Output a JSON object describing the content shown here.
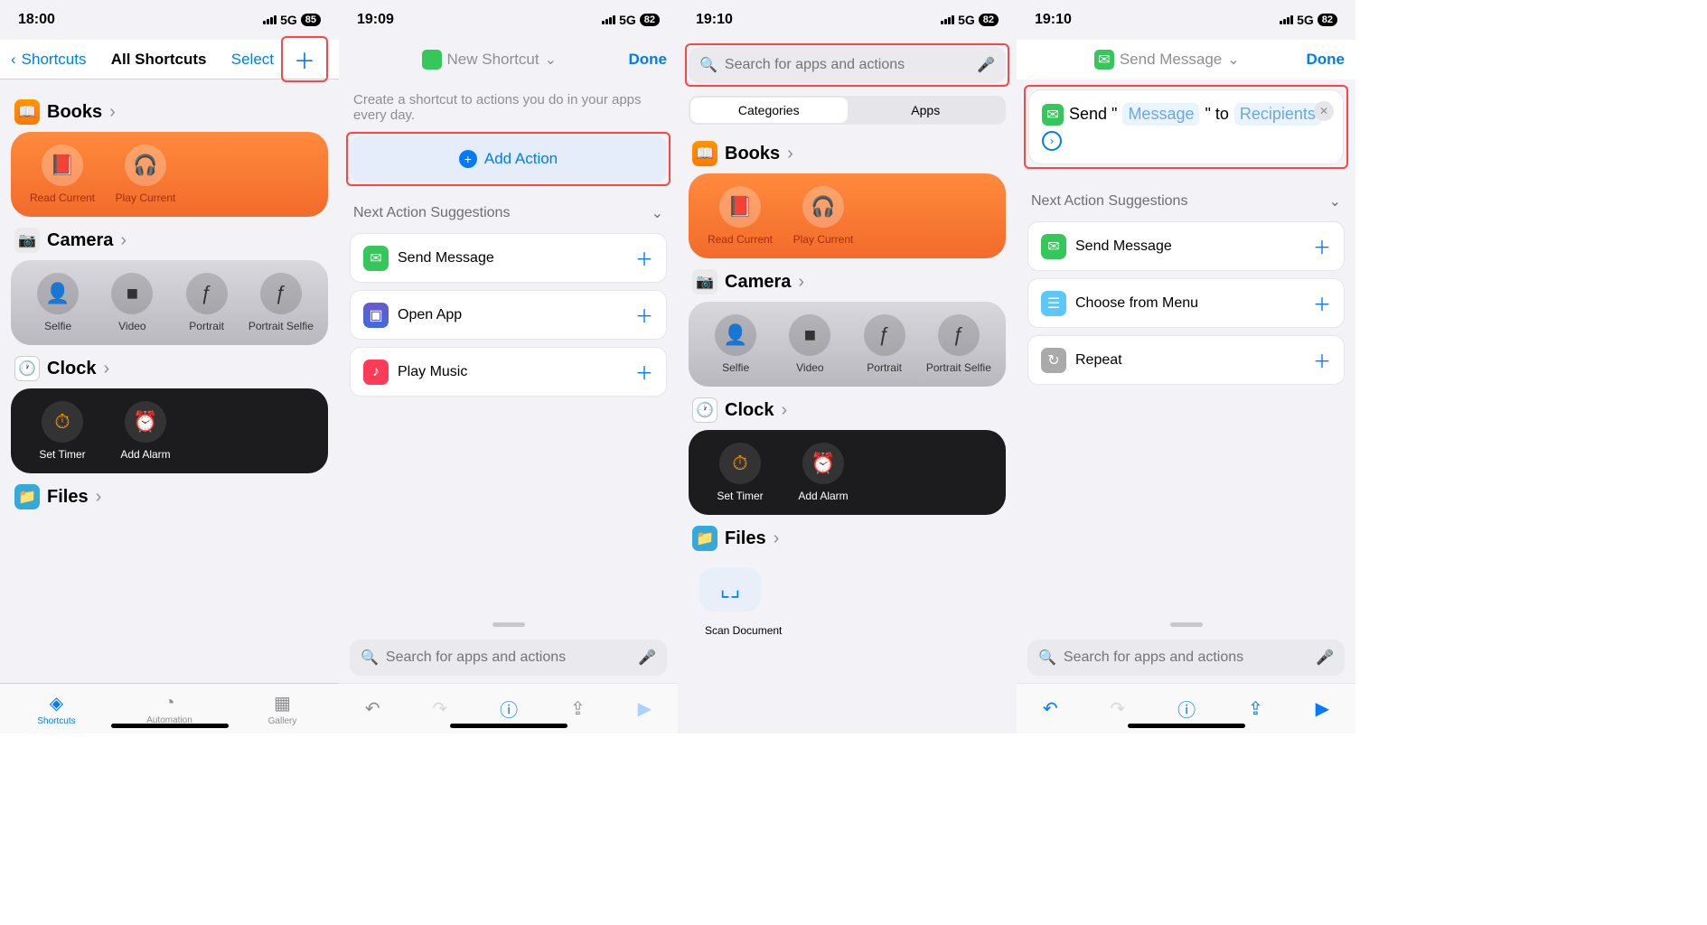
{
  "phone1": {
    "time": "18:00",
    "network": "5G",
    "battery": "85",
    "nav": {
      "back": "Shortcuts",
      "title": "All Shortcuts",
      "right": "Select"
    },
    "sections": {
      "books": {
        "title": "Books",
        "items": [
          "Read Current",
          "Play Current"
        ]
      },
      "camera": {
        "title": "Camera",
        "items": [
          "Selfie",
          "Video",
          "Portrait",
          "Portrait Selfie"
        ]
      },
      "clock": {
        "title": "Clock",
        "items": [
          "Set Timer",
          "Add Alarm"
        ]
      },
      "files": {
        "title": "Files"
      }
    },
    "tabs": [
      "Shortcuts",
      "Automation",
      "Gallery"
    ]
  },
  "phone2": {
    "time": "19:09",
    "network": "5G",
    "battery": "82",
    "nav": {
      "title": "New Shortcut",
      "done": "Done"
    },
    "instruction": "Create a shortcut to actions you do in your apps every day.",
    "add_action": "Add Action",
    "nas_header": "Next Action Suggestions",
    "suggestions": [
      "Send Message",
      "Open App",
      "Play Music"
    ],
    "search_placeholder": "Search for apps and actions"
  },
  "phone3": {
    "time": "19:10",
    "network": "5G",
    "battery": "82",
    "search_placeholder": "Search for apps and actions",
    "seg": [
      "Categories",
      "Apps"
    ],
    "sections": {
      "books": {
        "title": "Books",
        "items": [
          "Read Current",
          "Play Current"
        ]
      },
      "camera": {
        "title": "Camera",
        "items": [
          "Selfie",
          "Video",
          "Portrait",
          "Portrait Selfie"
        ]
      },
      "clock": {
        "title": "Clock",
        "items": [
          "Set Timer",
          "Add Alarm"
        ]
      },
      "files": {
        "title": "Files",
        "items": [
          "Scan Document"
        ]
      }
    }
  },
  "phone4": {
    "time": "19:10",
    "network": "5G",
    "battery": "82",
    "nav": {
      "title": "Send Message",
      "done": "Done"
    },
    "block": {
      "prefix": "Send \"",
      "msg": "Message",
      "mid": "\" to",
      "recipients": "Recipients"
    },
    "nas_header": "Next Action Suggestions",
    "suggestions": [
      "Send Message",
      "Choose from Menu",
      "Repeat"
    ],
    "search_placeholder": "Search for apps and actions"
  }
}
